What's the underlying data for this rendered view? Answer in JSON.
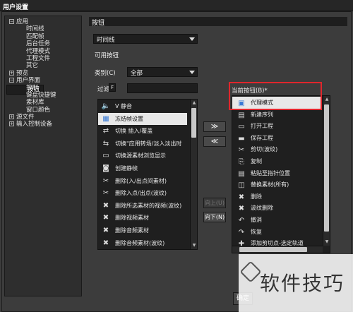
{
  "window": {
    "title": "用户设置"
  },
  "tree": {
    "items": [
      {
        "label": "应用",
        "level": 0,
        "exp": "−"
      },
      {
        "label": "时间线",
        "level": 1
      },
      {
        "label": "匹配帧",
        "level": 1
      },
      {
        "label": "后台任务",
        "level": 1
      },
      {
        "label": "代理模式",
        "level": 1
      },
      {
        "label": "工程文件",
        "level": 1
      },
      {
        "label": "其它",
        "level": 1
      },
      {
        "label": "预览",
        "level": 0,
        "exp": "+"
      },
      {
        "label": "用户界面",
        "level": 0,
        "exp": "−"
      },
      {
        "label": "按钮",
        "level": 1,
        "selected": true
      },
      {
        "label": "控制",
        "level": 1
      },
      {
        "label": "键盘快捷键",
        "level": 1
      },
      {
        "label": "素材库",
        "level": 1
      },
      {
        "label": "窗口颜色",
        "level": 1
      },
      {
        "label": "源文件",
        "level": 0,
        "exp": "+"
      },
      {
        "label": "输入控制设备",
        "level": 0,
        "exp": "+"
      }
    ]
  },
  "panel": {
    "header": "按钮",
    "target_select": "时间线",
    "available_label": "可用按钮",
    "category_label": "类别(C)",
    "category_value": "全部",
    "filter_label": "过滤",
    "filter_key": "F",
    "current_label": "当前按钮(B)*"
  },
  "available_items": [
    {
      "label": "V 静音",
      "icon": "🔈"
    },
    {
      "label": "冻结帧设置",
      "icon": "▦",
      "highlight": true
    },
    {
      "label": "切换 插入/覆盖",
      "icon": "⇄"
    },
    {
      "label": "切换\"应用转场/淡入淡出时",
      "icon": "⇆"
    },
    {
      "label": "切换源素材浏览显示",
      "icon": "▭"
    },
    {
      "label": "创建静帧",
      "icon": "◙"
    },
    {
      "label": "删除(入/出点间素材)",
      "icon": "✂"
    },
    {
      "label": "删除入点/出点(波纹)",
      "icon": "✂"
    },
    {
      "label": "删除所选素材的视频(波纹)",
      "icon": "✖"
    },
    {
      "label": "删除视频素材",
      "icon": "✖"
    },
    {
      "label": "删除音频素材",
      "icon": "✖"
    },
    {
      "label": "删除音频素材(波纹)",
      "icon": "✖"
    }
  ],
  "current_items": [
    {
      "label": "代理模式",
      "icon": "▣",
      "highlight": true
    },
    {
      "label": "新建序列",
      "icon": "▤"
    },
    {
      "label": "打开工程",
      "icon": "▭"
    },
    {
      "label": "保存工程",
      "icon": "▬"
    },
    {
      "label": "剪切(波纹)",
      "icon": "✂"
    },
    {
      "label": "复制",
      "icon": "⎘"
    },
    {
      "label": "粘贴至指针位置",
      "icon": "▤"
    },
    {
      "label": "替换素材(所有)",
      "icon": "◫"
    },
    {
      "label": "删除",
      "icon": "✖"
    },
    {
      "label": "波纹删除",
      "icon": "✖"
    },
    {
      "label": "撤消",
      "icon": "↶"
    },
    {
      "label": "恢复",
      "icon": "↷"
    },
    {
      "label": "添加剪切点-选定轨道",
      "icon": "✚"
    }
  ],
  "buttons": {
    "add": "≫",
    "remove": "≪",
    "up": "向上(U)",
    "down": "向下(N)",
    "ok": "确定"
  },
  "watermark": {
    "text": "软件技巧"
  },
  "colors": {
    "highlight_box": "#e0262c",
    "selection_bg": "#e8e8e8"
  }
}
